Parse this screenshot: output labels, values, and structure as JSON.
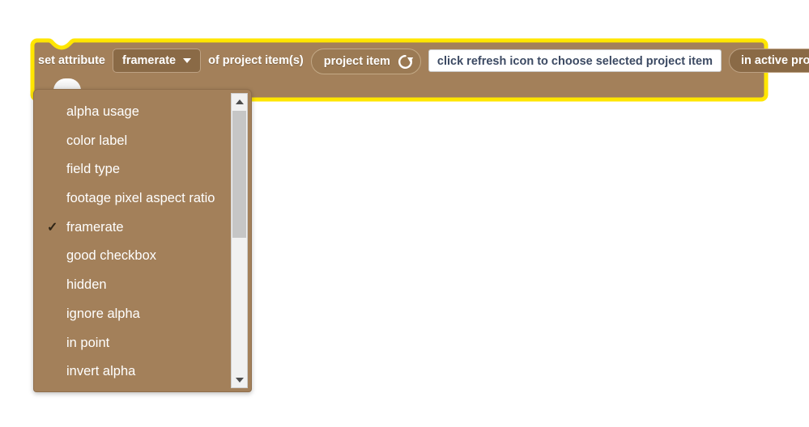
{
  "colors": {
    "page_background": "#ffffff",
    "block_body": "#a3805a",
    "block_highlight_border": "#ffe600",
    "field_background": "#8a6a46",
    "reporter_background": "#9b7a54",
    "menu_background": "#a3805a",
    "input_text": "#3c4a63",
    "label_text": "#ffffff",
    "checkmark": "#2e2416",
    "scrollbar_track": "#f1f1f1",
    "scrollbar_thumb": "#c6c6c6"
  },
  "block": {
    "name": "set-attribute-block",
    "selected": true,
    "label_prefix": "set attribute",
    "attribute_field": {
      "name": "attribute-dropdown",
      "value": "framerate",
      "caret_icon": "chevron-down-icon"
    },
    "label_middle": "of project item(s)",
    "reporter": {
      "name": "project-item-reporter",
      "label": "project item",
      "icon": "refresh-icon"
    },
    "text_input": {
      "name": "project-item-input",
      "value": "click refresh icon to choose selected project item",
      "placeholder": "click refresh icon to choose selected project item"
    },
    "scope_field": {
      "name": "project-scope-dropdown",
      "value": "in active project",
      "caret_icon": "chevron-down-icon"
    }
  },
  "dropdown_menu": {
    "name": "attribute-dropdown-menu",
    "selected_value": "framerate",
    "checkmark_glyph": "✓",
    "items": [
      {
        "label": "alpha usage",
        "checked": false
      },
      {
        "label": "color label",
        "checked": false
      },
      {
        "label": "field type",
        "checked": false
      },
      {
        "label": "footage pixel aspect ratio",
        "checked": false
      },
      {
        "label": "framerate",
        "checked": true
      },
      {
        "label": "good checkbox",
        "checked": false
      },
      {
        "label": "hidden",
        "checked": false
      },
      {
        "label": "ignore alpha",
        "checked": false
      },
      {
        "label": "in point",
        "checked": false
      },
      {
        "label": "invert alpha",
        "checked": false
      }
    ],
    "scrollbar": {
      "name": "menu-scrollbar",
      "up_arrow_icon": "triangle-up-icon",
      "down_arrow_icon": "triangle-down-icon",
      "thumb_position_percent": 0,
      "thumb_size_percent": 45
    }
  }
}
